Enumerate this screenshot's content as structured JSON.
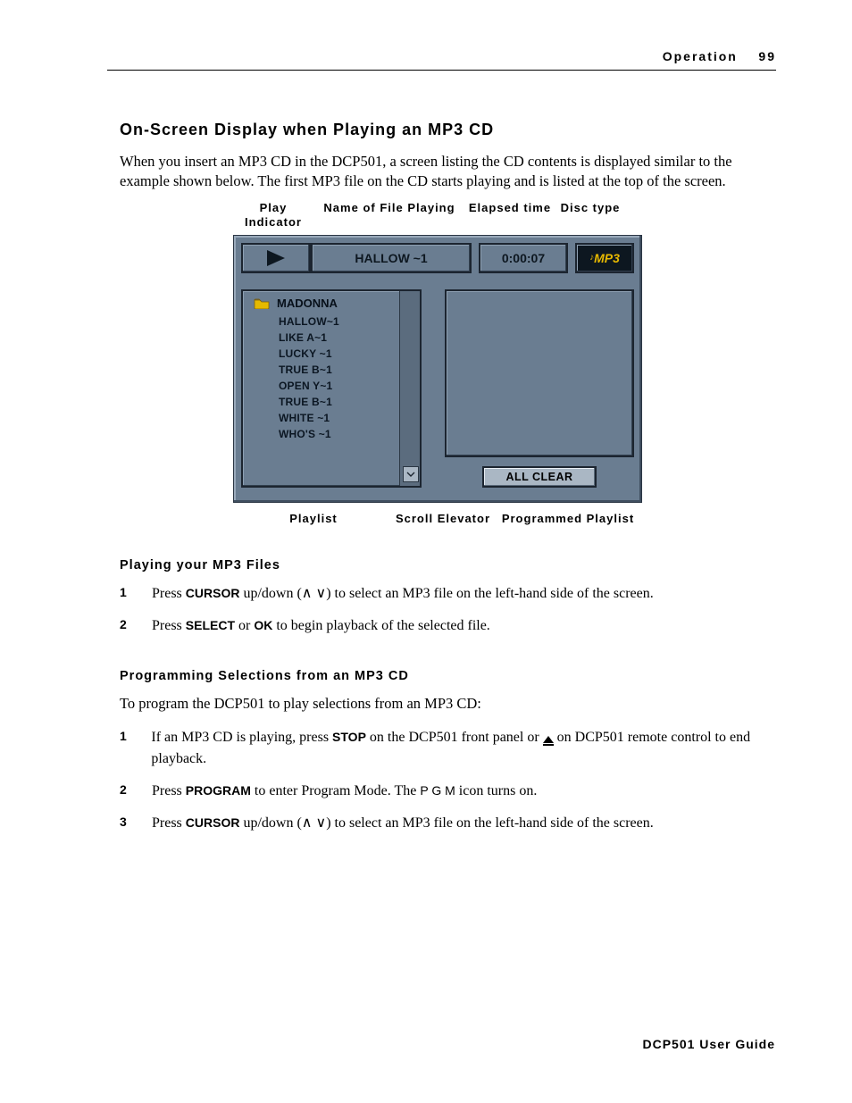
{
  "header": {
    "section": "Operation",
    "page_no": "99"
  },
  "footer": "DCP501 User Guide",
  "title": "On-Screen Display when Playing an MP3 CD",
  "intro": "When you insert an MP3 CD in the DCP501, a screen listing the CD contents is displayed similar to the example shown below. The first MP3 file on the CD starts playing and is listed at the top of the screen.",
  "callout_top": {
    "play": "Play Indicator",
    "file": "Name of File Playing",
    "time": "Elapsed time",
    "type": "Disc type"
  },
  "osd": {
    "file_playing": "HALLOW ~1",
    "elapsed": "0:00:07",
    "disc_type": "MP3",
    "folder": "MADONNA",
    "tracks": [
      "HALLOW~1",
      "LIKE A~1",
      "LUCKY ~1",
      "TRUE B~1",
      "OPEN Y~1",
      "TRUE B~1",
      "WHITE ~1",
      "WHO'S ~1"
    ],
    "all_clear": "ALL CLEAR"
  },
  "callout_bot": {
    "playlist": "Playlist",
    "scroll": "Scroll Elevator",
    "prog": "Programmed Playlist"
  },
  "sub1": {
    "title": "Playing your MP3 Files",
    "steps": [
      {
        "pre": "Press ",
        "kw": "CURSOR",
        "post": " up/down (∧ ∨) to select an MP3 file on the left-hand side of the screen."
      },
      {
        "pre": "Press ",
        "kw": "SELECT",
        "mid": " or ",
        "kw2": "OK",
        "post": " to begin playback of the selected file."
      }
    ]
  },
  "sub2": {
    "title": "Programming Selections from an MP3 CD",
    "lead": "To program the DCP501 to play selections from an MP3 CD:",
    "steps": [
      {
        "pre": "If an MP3 CD is playing, press ",
        "kw": "STOP",
        "mid": " on the DCP501 front panel or ",
        "icon": "eject",
        "post": " on DCP501 remote control to end playback."
      },
      {
        "pre": "Press ",
        "kw": "PROGRAM",
        "mid": " to enter Program Mode. The ",
        "mono": "P G M",
        "post": " icon turns on."
      },
      {
        "pre": "Press ",
        "kw": "CURSOR",
        "post": " up/down (∧ ∨) to select an MP3 file on the left-hand side of the screen."
      }
    ]
  }
}
